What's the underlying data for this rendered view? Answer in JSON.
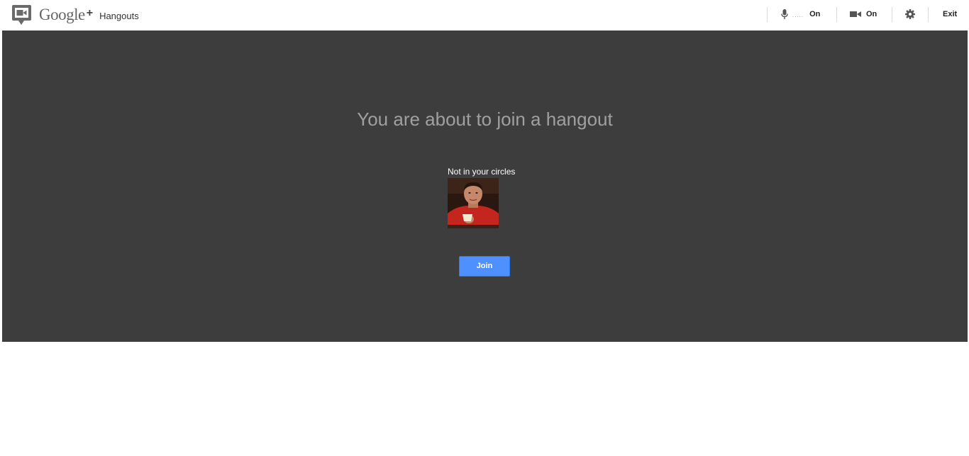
{
  "header": {
    "brand_google": "Google",
    "brand_plus": "+",
    "product_name": "Hangouts",
    "microphone": {
      "level_indicator": ".....",
      "status": "On",
      "icon": "microphone-icon"
    },
    "camera": {
      "status": "On",
      "icon": "video-camera-icon"
    },
    "settings": {
      "icon": "gear-icon"
    },
    "exit_label": "Exit"
  },
  "main": {
    "heading": "You are about to join a hangout",
    "participant": {
      "status_text": "Not in your circles",
      "avatar_description": "profile photo"
    },
    "join_button_label": "Join"
  },
  "colors": {
    "stage_background": "#3d3d3d",
    "heading_text": "#a0a0a0",
    "join_button": "#4d90fe"
  }
}
